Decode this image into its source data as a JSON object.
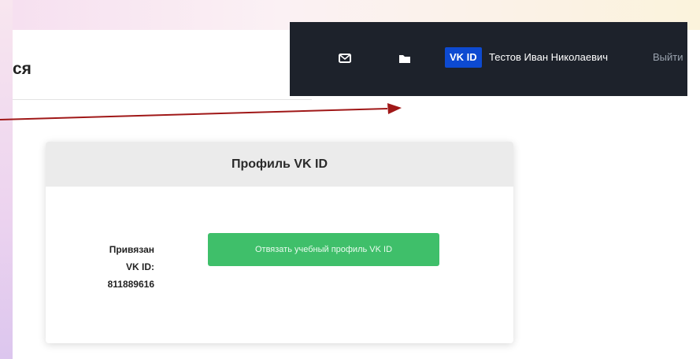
{
  "page": {
    "title_fragment": "ся"
  },
  "navbar": {
    "mail_icon": "mail-icon",
    "folder_icon": "folder-icon",
    "vkid_badge": "VK ID",
    "user_name": "Тестов Иван Николаевич",
    "logout_label": "Выйти"
  },
  "card": {
    "title": "Профиль VK ID",
    "linked_line1": "Привязан",
    "linked_line2": "VK ID:",
    "linked_line3": "811889616",
    "unlink_button": "Отвязать учебный профиль VK ID"
  },
  "colors": {
    "navbar_bg": "#1d222b",
    "vkid_blue": "#0d4ad1",
    "button_green": "#3fbf6a",
    "arrow_red": "#a01818"
  }
}
